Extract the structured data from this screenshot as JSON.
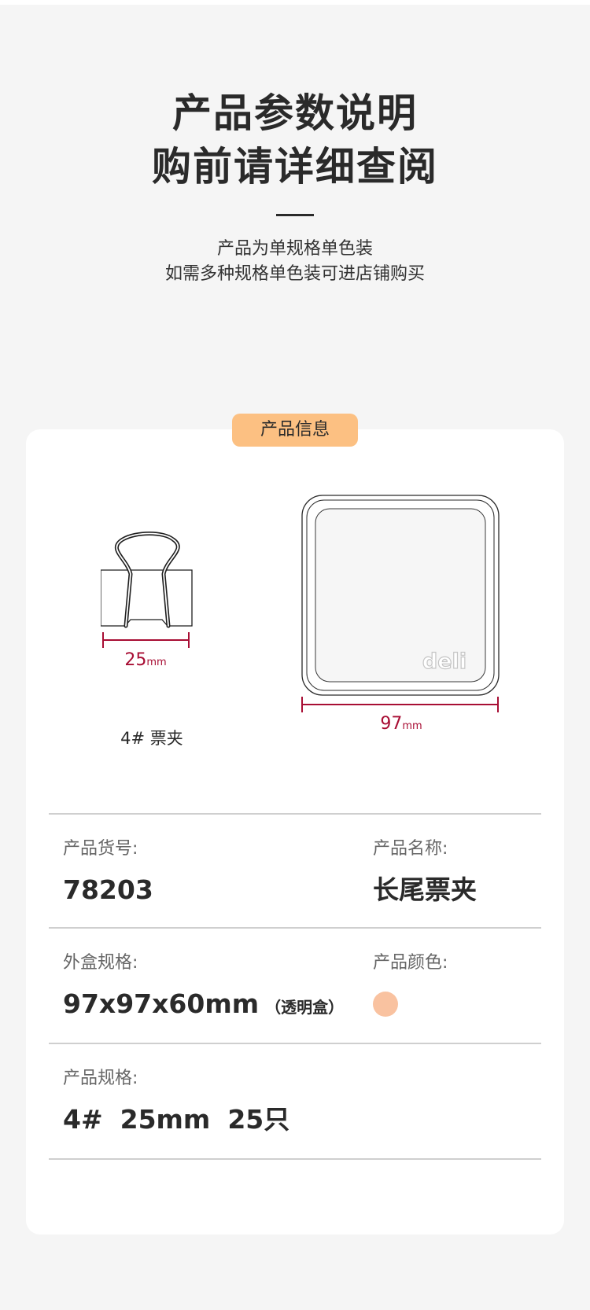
{
  "header": {
    "title_line1": "产品参数说明",
    "title_line2": "购前请详细查阅",
    "subtitle_line1": "产品为单规格单色装",
    "subtitle_line2": "如需多种规格单色装可进店铺购买"
  },
  "card": {
    "tag_label": "产品信息",
    "clip_dimension": "25",
    "clip_dimension_unit": "mm",
    "clip_caption": "4# 票夹",
    "box_dimension": "97",
    "box_dimension_unit": "mm",
    "box_logo": "deli"
  },
  "specs": {
    "item_no_label": "产品货号:",
    "item_no_value": "78203",
    "name_label": "产品名称:",
    "name_value": "长尾票夹",
    "box_size_label": "外盒规格:",
    "box_size_value": "97x97x60mm",
    "box_size_note": "（透明盒）",
    "color_label": "产品颜色:",
    "color_swatch": "#f9c2a0",
    "spec_label": "产品规格:",
    "spec_values": [
      "4#",
      "25mm",
      "25只"
    ]
  },
  "colors": {
    "background": "#f5f5f5",
    "tag": "#fcc082",
    "dimension": "#a80e34",
    "divider": "#cfcfcf"
  }
}
